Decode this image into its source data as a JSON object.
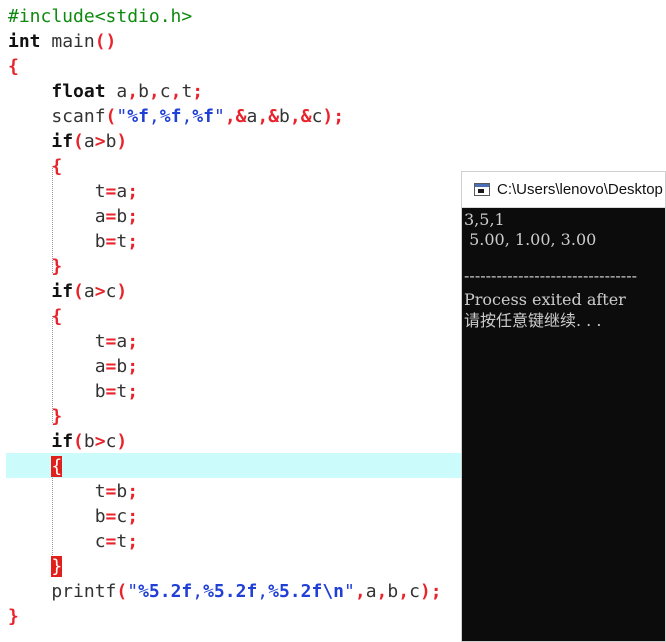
{
  "editor": {
    "lines": [
      [
        "#include<stdio.h>"
      ],
      [
        "int",
        " main",
        "()"
      ],
      [
        "{"
      ],
      [
        "    ",
        "float",
        " a",
        ",",
        "b",
        ",",
        "c",
        ",",
        "t",
        ";"
      ],
      [
        "    scanf",
        "(",
        "\"",
        "%f",
        ",",
        "%f",
        ",",
        "%f",
        "\"",
        ",",
        "&",
        "a",
        ",",
        "&",
        "b",
        ",",
        "&",
        "c",
        ");"
      ],
      [
        "    ",
        "if",
        "(",
        "a",
        ">",
        "b",
        ")"
      ],
      [
        "    ",
        "{"
      ],
      [
        "        t",
        "=",
        "a",
        ";"
      ],
      [
        "        a",
        "=",
        "b",
        ";"
      ],
      [
        "        b",
        "=",
        "t",
        ";"
      ],
      [
        "    ",
        "}"
      ],
      [
        "    ",
        "if",
        "(",
        "a",
        ">",
        "c",
        ")"
      ],
      [
        "    ",
        "{"
      ],
      [
        "        t",
        "=",
        "a",
        ";"
      ],
      [
        "        a",
        "=",
        "b",
        ";"
      ],
      [
        "        b",
        "=",
        "t",
        ";"
      ],
      [
        "    ",
        "}"
      ],
      [
        "    ",
        "if",
        "(",
        "b",
        ">",
        "c",
        ")"
      ],
      [
        "    ",
        "{"
      ],
      [
        "        t",
        "=",
        "b",
        ";"
      ],
      [
        "        b",
        "=",
        "c",
        ";"
      ],
      [
        "        c",
        "=",
        "t",
        ";"
      ],
      [
        "    ",
        "}"
      ],
      [
        "    printf",
        "(",
        "\"",
        "%5.2f",
        ",",
        "%5.2f",
        ",",
        "%5.2f",
        "\\n",
        "\"",
        ",",
        "a",
        ",",
        "b",
        ",",
        "c",
        ");"
      ],
      [
        "}"
      ]
    ]
  },
  "console": {
    "title": "C:\\Users\\lenovo\\Desktop",
    "output": [
      "3,5,1",
      " 5.00, 1.00, 3.00",
      "",
      "--------------------------------",
      "Process exited after",
      "请按任意键继续. . ."
    ]
  }
}
